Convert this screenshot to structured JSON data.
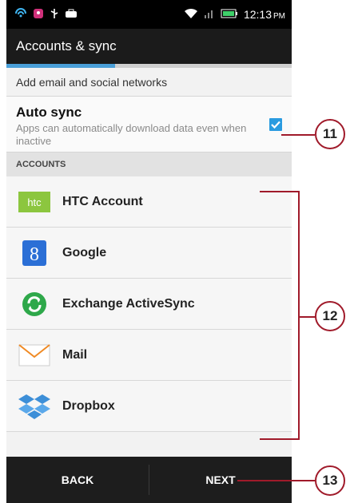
{
  "status_bar": {
    "time": "12:13",
    "ampm": "PM",
    "icons": [
      "lte-icon",
      "notification-app-icon",
      "usb-icon",
      "bag-icon",
      "wifi-icon",
      "signal-icon",
      "battery-icon"
    ]
  },
  "header": {
    "title": "Accounts & sync",
    "progress": 0.38
  },
  "add_networks": {
    "label": "Add email and social networks"
  },
  "auto_sync": {
    "title": "Auto sync",
    "description": "Apps can automatically download data even when inactive",
    "checked": true
  },
  "accounts_section": {
    "header": "ACCOUNTS"
  },
  "accounts": [
    {
      "label": "HTC Account",
      "icon": "htc-icon"
    },
    {
      "label": "Google",
      "icon": "google-icon"
    },
    {
      "label": "Exchange ActiveSync",
      "icon": "exchange-icon"
    },
    {
      "label": "Mail",
      "icon": "mail-icon"
    },
    {
      "label": "Dropbox",
      "icon": "dropbox-icon"
    }
  ],
  "bottom_bar": {
    "back": "BACK",
    "next": "NEXT"
  },
  "callouts": {
    "c11": "11",
    "c12": "12",
    "c13": "13"
  },
  "colors": {
    "accent": "#2a9be0",
    "callout": "#a01a2a",
    "bar": "#1d1d1d"
  }
}
